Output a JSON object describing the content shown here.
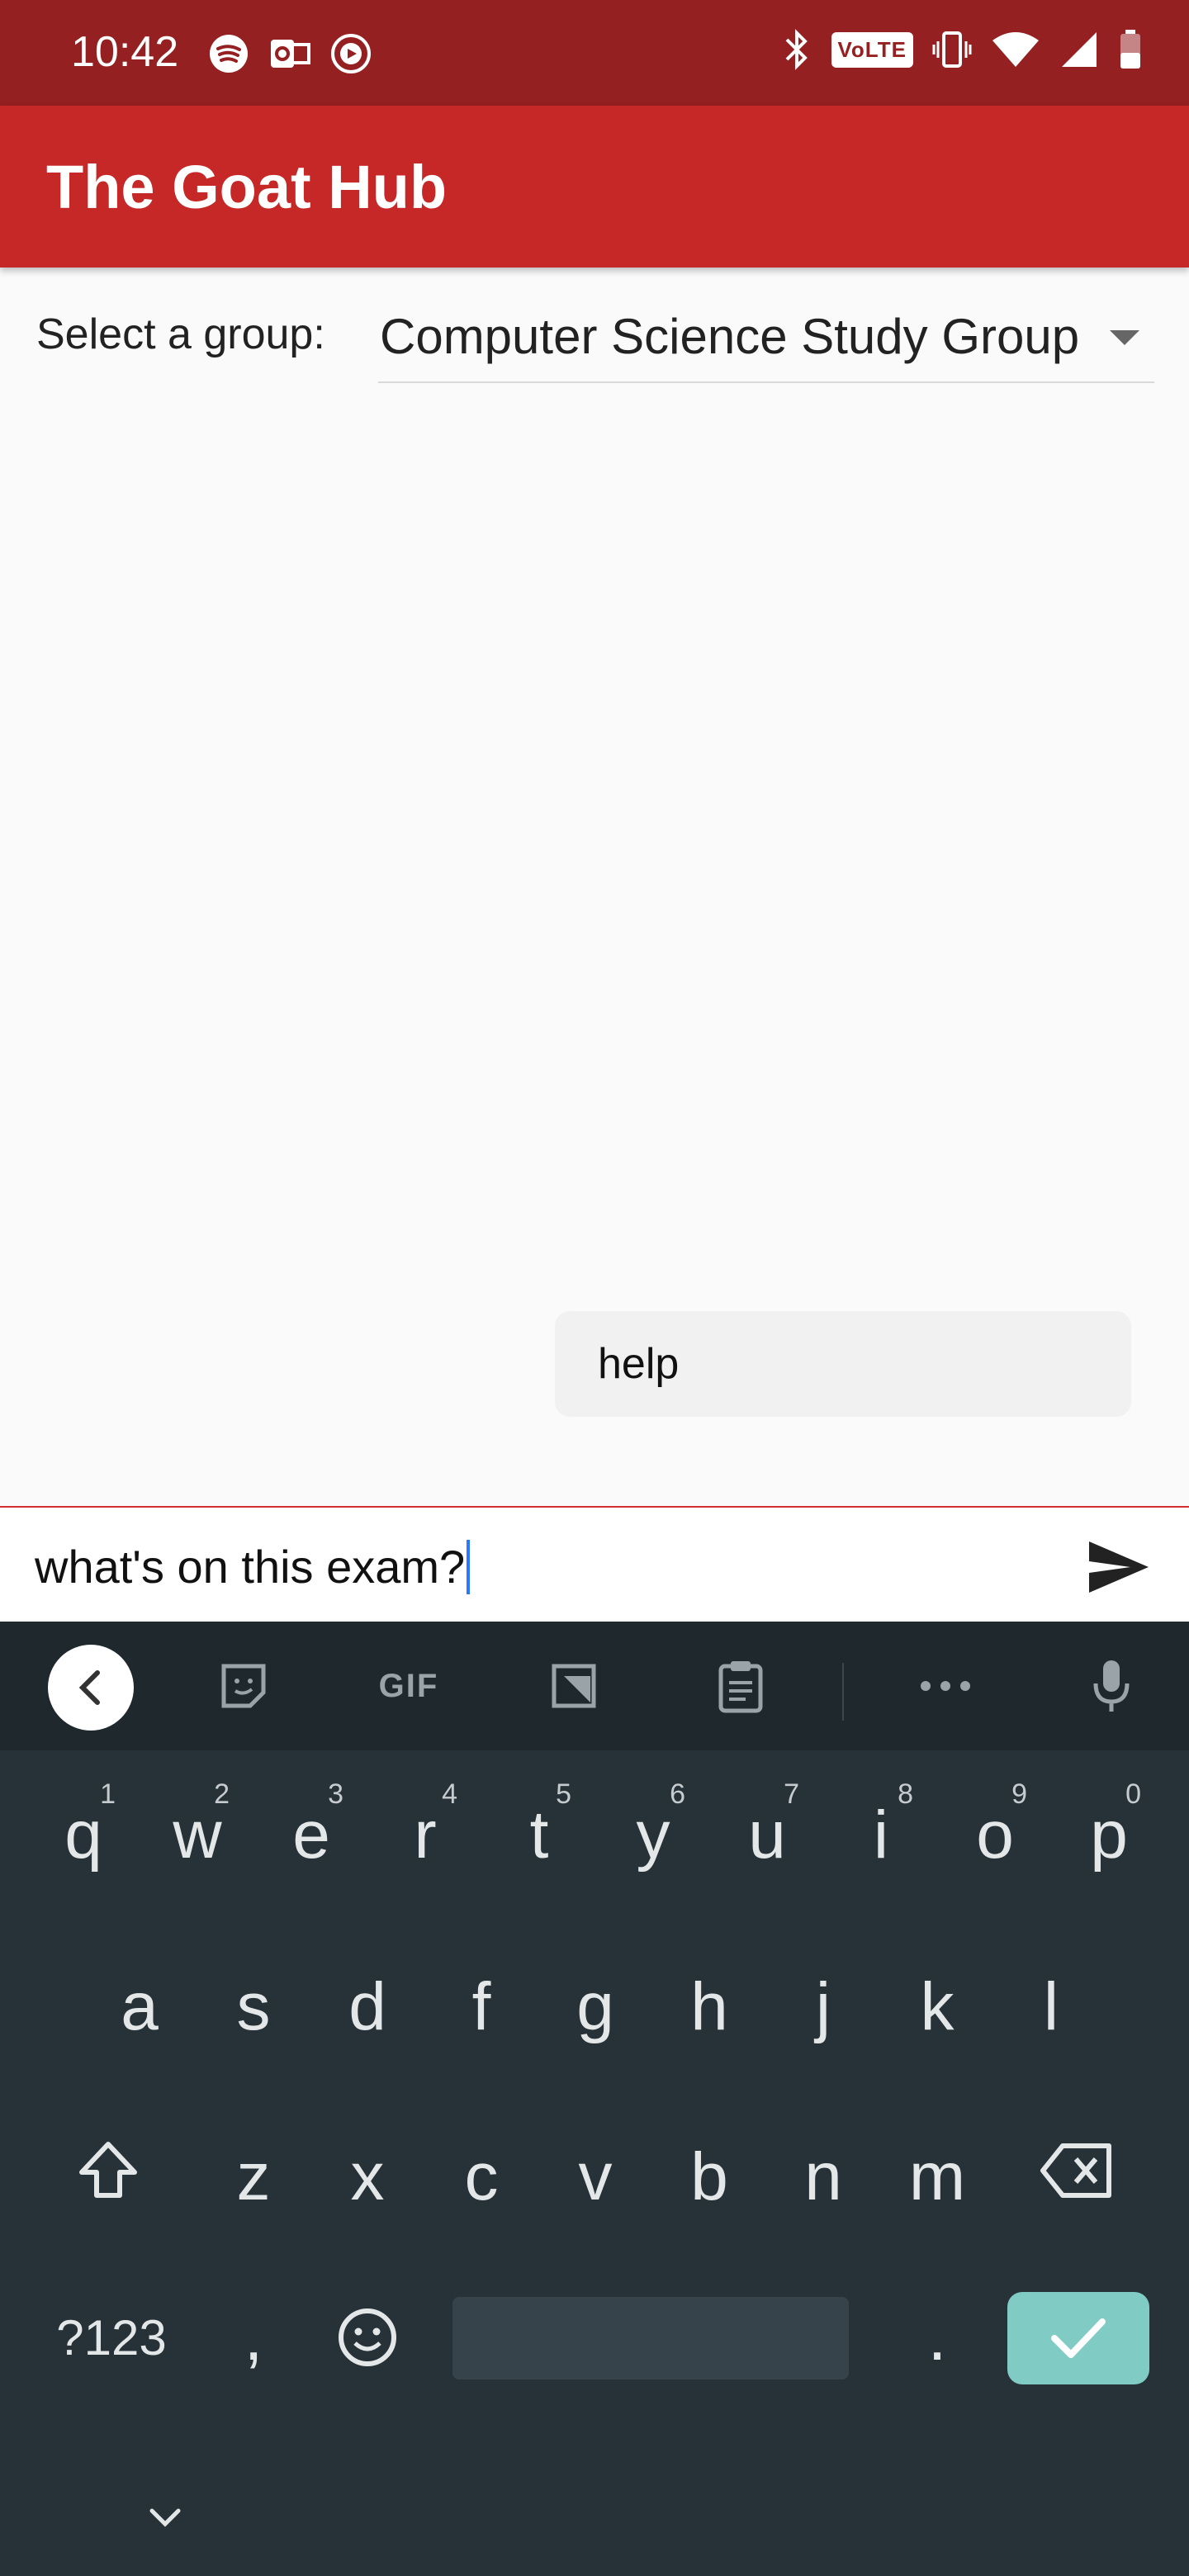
{
  "status_bar": {
    "time": "10:42",
    "left_icons": [
      "spotify-icon",
      "outlook-icon",
      "youtube-music-icon"
    ],
    "network_label": "VoLTE",
    "right_icons": [
      "bluetooth-icon",
      "volte-icon",
      "vibrate-icon",
      "wifi-icon",
      "signal-icon",
      "battery-icon"
    ]
  },
  "app_bar": {
    "title": "The Goat Hub",
    "color": "#c62828"
  },
  "group_selector": {
    "label": "Select a group:",
    "value": "Computer Science Study Group"
  },
  "messages": [
    {
      "text": "help"
    }
  ],
  "composer": {
    "value": "what's on this exam?"
  },
  "keyboard": {
    "toolbar": [
      "back-icon",
      "sticker-icon",
      "GIF",
      "clipboard-translate-icon",
      "clipboard-icon",
      "more-icon",
      "mic-icon"
    ],
    "gif_label": "GIF",
    "row1": [
      {
        "k": "q",
        "h": "1"
      },
      {
        "k": "w",
        "h": "2"
      },
      {
        "k": "e",
        "h": "3"
      },
      {
        "k": "r",
        "h": "4"
      },
      {
        "k": "t",
        "h": "5"
      },
      {
        "k": "y",
        "h": "6"
      },
      {
        "k": "u",
        "h": "7"
      },
      {
        "k": "i",
        "h": "8"
      },
      {
        "k": "o",
        "h": "9"
      },
      {
        "k": "p",
        "h": "0"
      }
    ],
    "row2": [
      "a",
      "s",
      "d",
      "f",
      "g",
      "h",
      "j",
      "k",
      "l"
    ],
    "row3": [
      "z",
      "x",
      "c",
      "v",
      "b",
      "n",
      "m"
    ],
    "sym_label": "?123",
    "comma": ",",
    "period": ".",
    "accent": "#80cbc4"
  }
}
